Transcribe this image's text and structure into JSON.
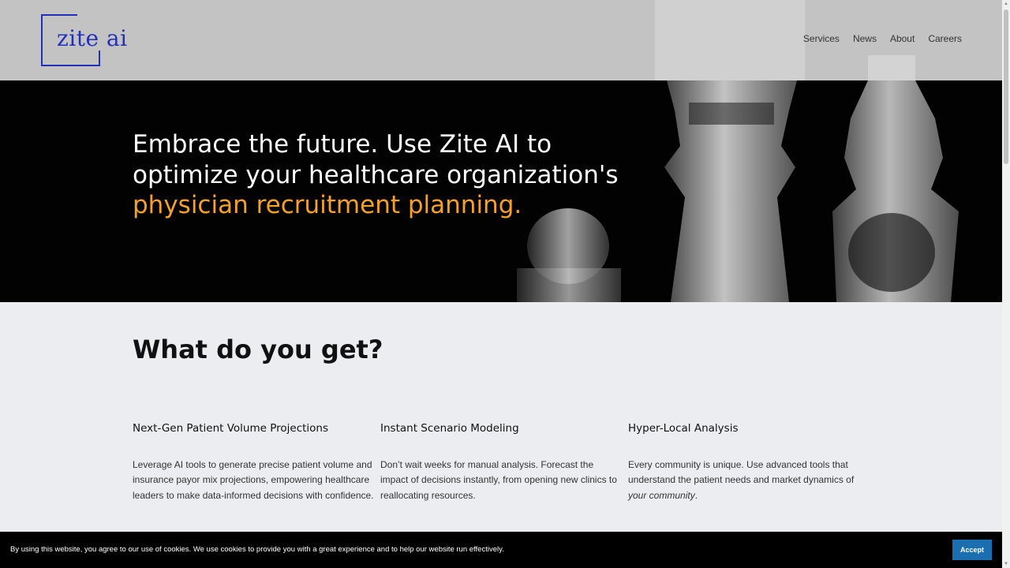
{
  "brand": {
    "logo_text": "zite ai",
    "logo_color": "#2330b8"
  },
  "nav": {
    "items": [
      "Services",
      "News",
      "About",
      "Careers"
    ]
  },
  "hero": {
    "text_plain": "Embrace the future. Use Zite AI to optimize your healthcare organization's",
    "text_accent": "physician recruitment planning.",
    "accent_color": "#f5a027"
  },
  "benefits": {
    "title": "What do you get?",
    "items": [
      {
        "title": "Next-Gen Patient Volume Projections",
        "body": "Leverage AI tools to generate precise patient volume and insurance payor mix projections, empowering healthcare leaders to make data-informed decisions with confidence."
      },
      {
        "title": "Instant Scenario Modeling",
        "body": "Don’t wait weeks for manual analysis. Forecast the impact of decisions instantly, from opening new clinics to reallocating resources."
      },
      {
        "title": "Hyper-Local Analysis",
        "body": "Every community is unique. Use advanced tools that understand the patient needs and market dynamics of",
        "body_em": "your community",
        "body_end": "."
      }
    ]
  },
  "cookie": {
    "text": "By using this website, you agree to our use of cookies. We use cookies to provide you with a great experience and to help our website run effectively.",
    "accept_label": "Accept",
    "accept_color": "#1b6fb0"
  }
}
